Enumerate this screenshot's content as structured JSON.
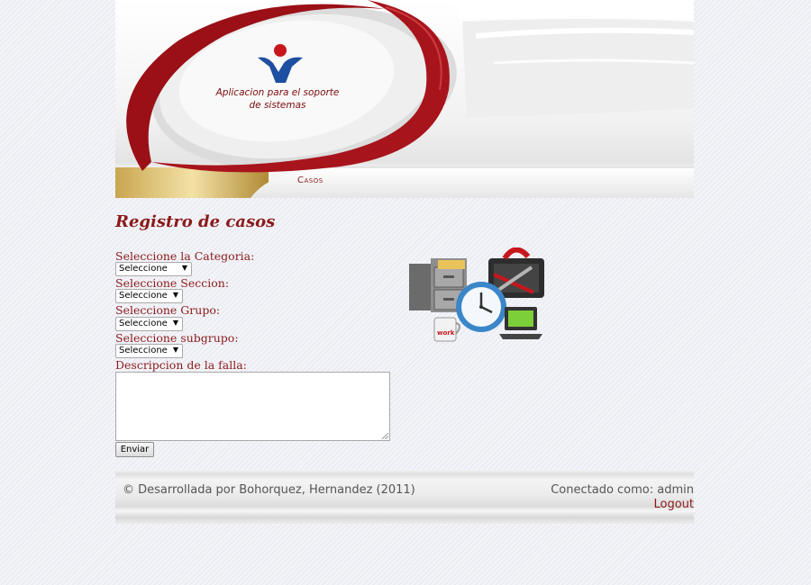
{
  "header": {
    "app_title_line1": "Aplicacion para el soporte",
    "app_title_line2": "de sistemas",
    "logo_icon": "person-logo-icon",
    "nav": {
      "casos": "Casos"
    }
  },
  "main": {
    "title": "Registro de casos",
    "form": {
      "categoria_label": "Seleccione la Categoria:",
      "categoria_value": "Seleccione",
      "seccion_label": "Seleccione Seccion:",
      "seccion_value": "Seleccione",
      "grupo_label": "Seleccione Grupo:",
      "grupo_value": "Seleccione",
      "subgrupo_label": "Seleccione subgrupo:",
      "subgrupo_value": "Seleccione",
      "descripcion_label": "Descripcion de la falla:",
      "descripcion_value": "",
      "submit_label": "Enviar"
    },
    "illustration": {
      "icon": "work-tools-clipart-icon",
      "mug_text": "work"
    }
  },
  "footer": {
    "copyright": "© Desarrollada por Bohorquez, Hernandez (2011)",
    "connected": "Conectado como: admin",
    "logout": "Logout"
  },
  "colors": {
    "accent": "#8b1a1a",
    "swoosh": "#9a1016",
    "logo_blue": "#1f4fa0",
    "logo_red": "#c8161d"
  }
}
